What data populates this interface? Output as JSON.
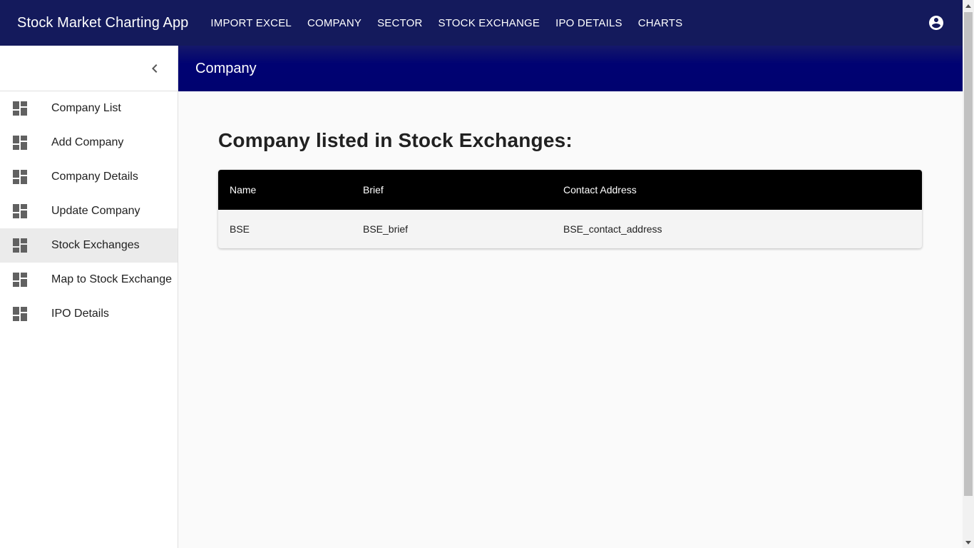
{
  "app": {
    "title": "Stock Market Charting App"
  },
  "topnav": [
    {
      "label": "IMPORT EXCEL"
    },
    {
      "label": "COMPANY"
    },
    {
      "label": "SECTOR"
    },
    {
      "label": "STOCK EXCHANGE"
    },
    {
      "label": "IPO DETAILS"
    },
    {
      "label": "CHARTS"
    }
  ],
  "sidebar": {
    "items": [
      {
        "label": "Company List",
        "icon": "dashboard-icon"
      },
      {
        "label": "Add Company",
        "icon": "dashboard-icon"
      },
      {
        "label": "Company Details",
        "icon": "dashboard-icon"
      },
      {
        "label": "Update Company",
        "icon": "dashboard-icon"
      },
      {
        "label": "Stock Exchanges",
        "icon": "dashboard-icon",
        "active": true
      },
      {
        "label": "Map to Stock Exchange",
        "icon": "dashboard-icon"
      },
      {
        "label": "IPO Details",
        "icon": "dashboard-icon"
      }
    ]
  },
  "content": {
    "header_title": "Company",
    "heading": "Company listed in Stock Exchanges:"
  },
  "table": {
    "columns": [
      "Name",
      "Brief",
      "Contact Address"
    ],
    "rows": [
      [
        "BSE",
        "BSE_brief",
        "BSE_contact_address"
      ]
    ]
  },
  "colors": {
    "topbar": "#141a5c",
    "content_header": "#000272",
    "table_header": "#000000",
    "active_item": "#ebebeb"
  }
}
